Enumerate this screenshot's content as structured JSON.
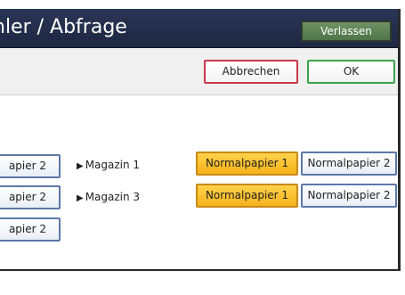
{
  "header": {
    "title": "hler / Abfrage",
    "exit_label": "Verlassen"
  },
  "toolbar": {
    "cancel_label": "Abbrechen",
    "ok_label": "OK"
  },
  "rows": [
    {
      "left_label": "apier 2",
      "arrow": "▶",
      "tray": "Magazin 1",
      "options": [
        "Normalpapier 1",
        "Normalpapier 2"
      ],
      "selected_index": 0
    },
    {
      "left_label": "apier 2",
      "arrow": "▶",
      "tray": "Magazin 3",
      "options": [
        "Normalpapier 1",
        "Normalpapier 2"
      ],
      "selected_index": 0
    },
    {
      "left_label": "apier 2"
    }
  ],
  "colors": {
    "title_bar": "#233050",
    "exit_button": "#5f8358",
    "selected_option": "#f8be2a",
    "cancel_border": "#c83a4c",
    "ok_border": "#3aa54a",
    "option_border": "#5d78a8"
  }
}
